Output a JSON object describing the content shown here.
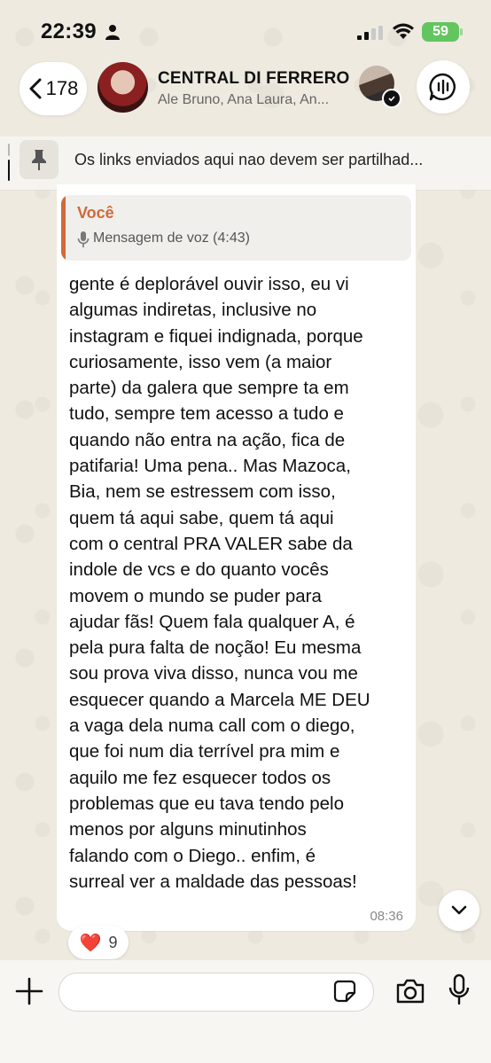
{
  "status_bar": {
    "time": "22:39",
    "battery": "59"
  },
  "header": {
    "back_count": "178",
    "group_name": "CENTRAL DI FERRERO",
    "members": "Ale Bruno, Ana Laura, An..."
  },
  "pinned": {
    "text": "Os links enviados aqui nao devem ser partilhad..."
  },
  "message": {
    "quote_author": "Você",
    "quote_text": "Mensagem de voz (4:43)",
    "body": "gente é deplorável ouvir isso, eu vi\nalgumas indiretas, inclusive no\ninstagram e fiquei indignada, porque\ncuriosamente, isso vem (a maior\nparte) da galera que sempre ta em\ntudo, sempre tem acesso a tudo e\nquando não entra na ação, fica de\npatifaria! Uma pena.. Mas Mazoca,\nBia, nem se estressem com isso,\nquem tá aqui sabe, quem tá aqui\ncom o central PRA VALER sabe da\nindole de vcs e do quanto vocês\nmovem o mundo se puder para\najudar fãs! Quem fala qualquer A, é\npela pura falta de noção! Eu mesma\nsou prova viva disso, nunca vou me\nesquecer quando a Marcela ME DEU\na vaga dela numa call com o diego,\nque foi num dia terrível pra mim e\naquilo me fez esquecer todos os\nproblemas que eu tava tendo pelo\nmenos por alguns minutinhos\nfalando com o Diego.. enfim, é\nsurreal ver a maldade das pessoas!",
    "time": "08:36",
    "reaction_emoji": "❤️",
    "reaction_count": "9"
  },
  "composer": {
    "placeholder": ""
  },
  "colors": {
    "accent_quote": "#cf6a3a",
    "battery": "#63c560"
  }
}
